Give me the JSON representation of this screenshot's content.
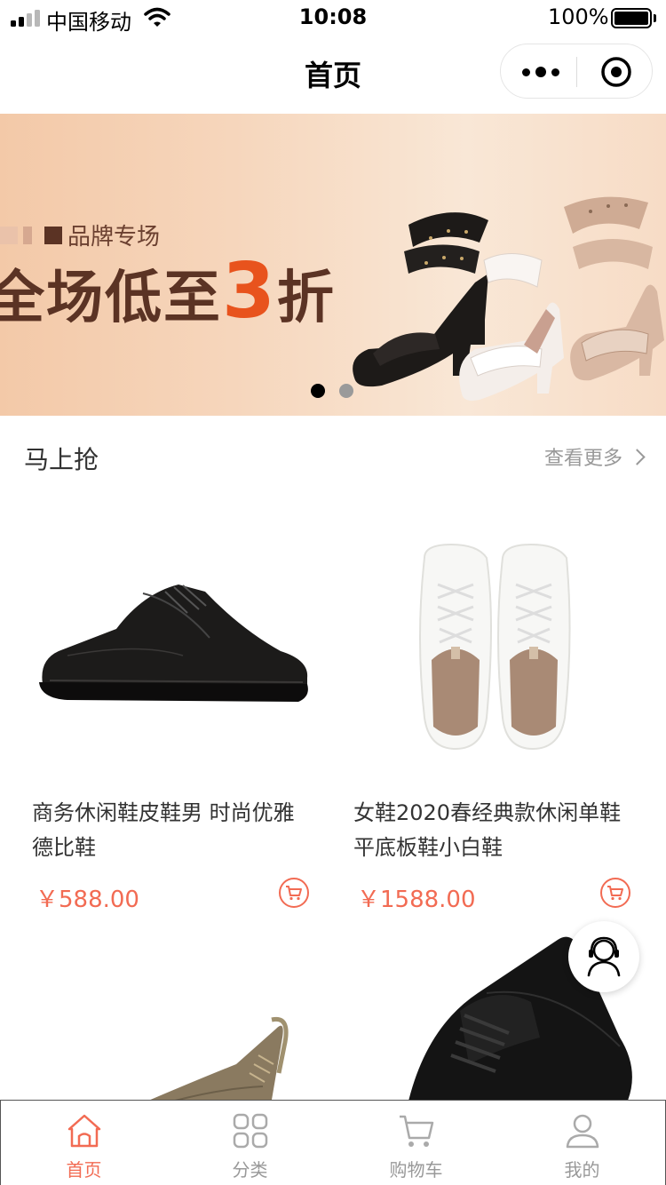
{
  "status_bar": {
    "carrier": "中国移动",
    "time": "10:08",
    "battery": "100%"
  },
  "nav": {
    "title": "首页"
  },
  "banner": {
    "brand_label": "品牌专场",
    "headline_prefix": "全场低至",
    "headline_number": "3",
    "headline_suffix": "折",
    "slide_count": 2,
    "active_slide": 1
  },
  "section": {
    "title": "马上抢",
    "more_label": "查看更多"
  },
  "products": [
    {
      "name": "商务休闲鞋皮鞋男 时尚优雅德比鞋",
      "price": "￥588.00"
    },
    {
      "name": "女鞋2020春经典款休闲单鞋平底板鞋小白鞋",
      "price": "￥1588.00"
    }
  ],
  "tabs": [
    {
      "label": "首页",
      "icon": "home-icon",
      "active": true
    },
    {
      "label": "分类",
      "icon": "category-grid-icon",
      "active": false
    },
    {
      "label": "购物车",
      "icon": "cart-icon",
      "active": false
    },
    {
      "label": "我的",
      "icon": "user-icon",
      "active": false
    }
  ],
  "colors": {
    "accent": "#f26b53",
    "banner_number": "#e8531d",
    "banner_text": "#5b3324"
  }
}
